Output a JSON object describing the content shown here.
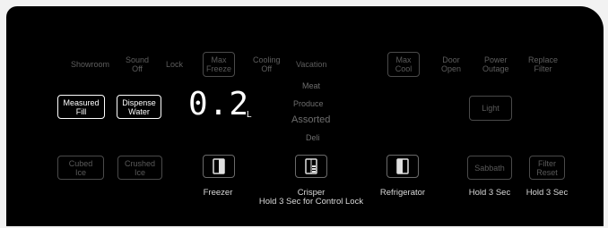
{
  "top_row": {
    "showroom": "Showroom",
    "sound_off": "Sound\nOff",
    "lock": "Lock",
    "max_freeze": "Max\nFreeze",
    "cooling_off": "Cooling\nOff",
    "vacation": "Vacation",
    "max_cool": "Max\nCool",
    "door_open": "Door\nOpen",
    "power_outage": "Power\nOutage",
    "replace_filter": "Replace\nFilter"
  },
  "dispenser": {
    "measured_fill": "Measured\nFill",
    "dispense_water": "Dispense\nWater",
    "display_value": "0.2",
    "display_unit": "L",
    "cubed_ice": "Cubed\nIce",
    "crushed_ice": "Crushed\nIce"
  },
  "crisper_modes": [
    "Meat",
    "Produce",
    "Assorted",
    "Deli"
  ],
  "light_label": "Light",
  "bottom": {
    "freezer": "Freezer",
    "crisper": "Crisper",
    "crisper_hint": "Hold 3 Sec for Control Lock",
    "refrigerator": "Refrigerator",
    "sabbath": "Sabbath",
    "sabbath_hint": "Hold 3 Sec",
    "filter_reset": "Filter\nReset",
    "filter_hint": "Hold 3 Sec"
  },
  "colors": {
    "active": "#ffffff",
    "inactive": "#5a5a5a",
    "background": "#000000"
  },
  "icons": [
    "freezer-door-icon",
    "crisper-drawer-icon",
    "refrigerator-door-icon"
  ]
}
